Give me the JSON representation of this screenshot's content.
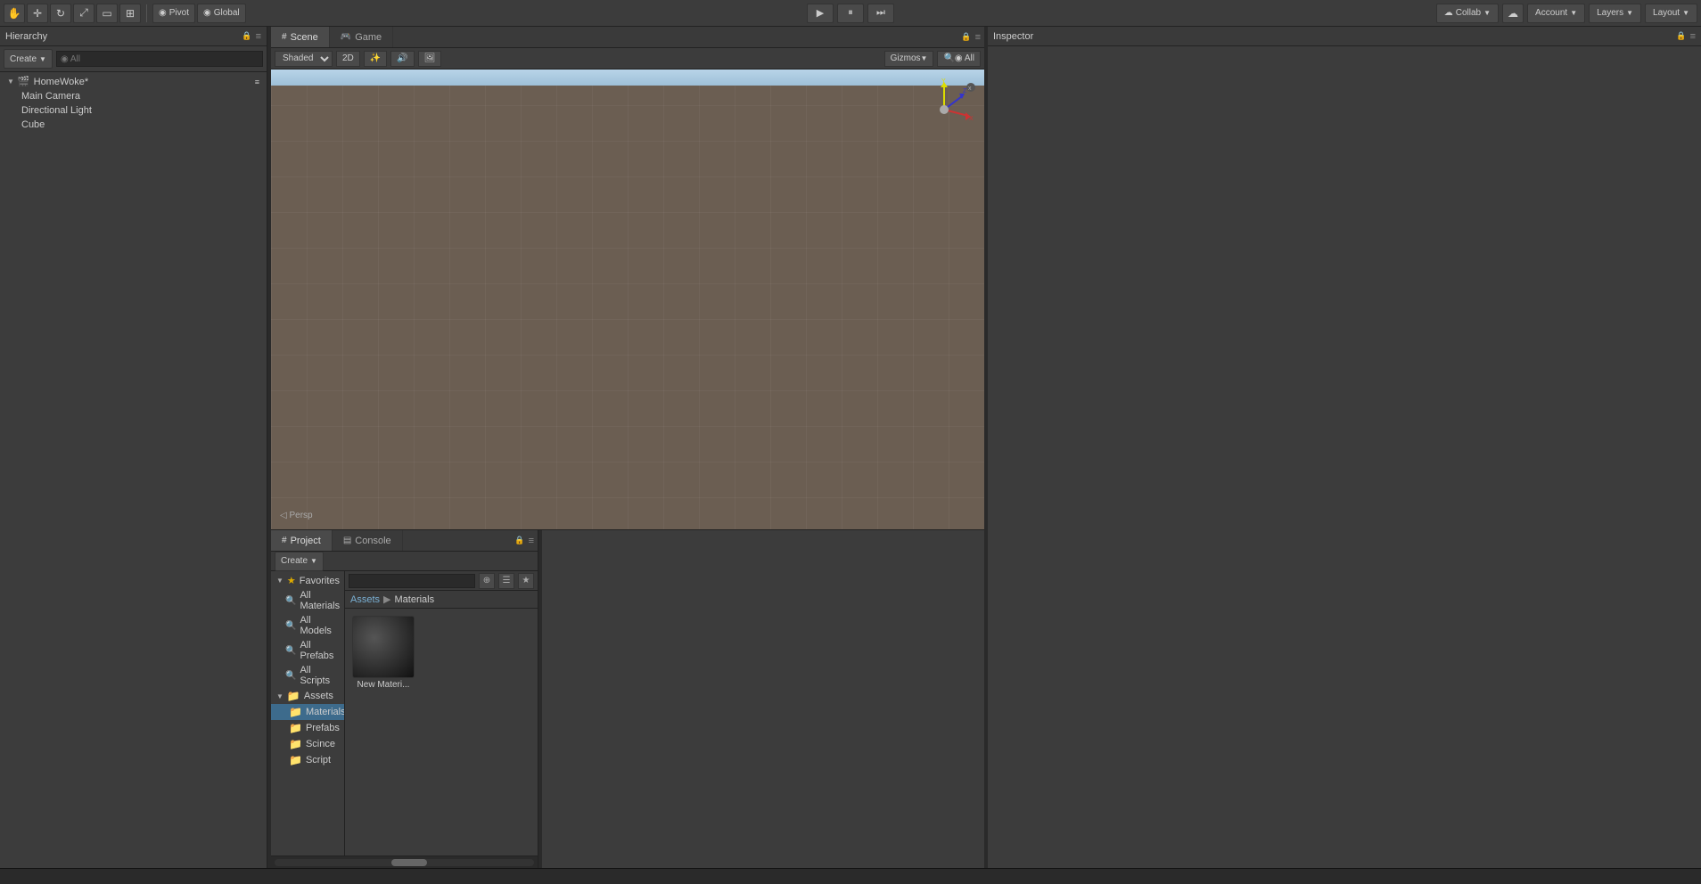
{
  "toolbar": {
    "pivot_label": "Pivot",
    "global_label": "Global",
    "collab_label": "Collab",
    "account_label": "Account",
    "layers_label": "Layers",
    "layout_label": "Layout"
  },
  "hierarchy": {
    "panel_title": "Hierarchy",
    "create_label": "Create",
    "search_placeholder": "◉ All",
    "scene_name": "HomeWoke*",
    "items": [
      {
        "label": "Main Camera",
        "indent": true
      },
      {
        "label": "Directional Light",
        "indent": true
      },
      {
        "label": "Cube",
        "indent": true
      }
    ]
  },
  "scene": {
    "tab_scene": "Scene",
    "tab_game": "Game",
    "shade_mode": "Shaded",
    "btn_2d": "2D",
    "gizmos_label": "Gizmos",
    "search_placeholder": "◉ All",
    "persp_label": "◁ Persp"
  },
  "inspector": {
    "panel_title": "Inspector"
  },
  "project": {
    "tab_project": "Project",
    "tab_console": "Console",
    "create_label": "Create",
    "search_placeholder": "",
    "favorites": {
      "label": "Favorites",
      "items": [
        {
          "label": "All Materials",
          "icon": "🔍"
        },
        {
          "label": "All Models",
          "icon": "🔍"
        },
        {
          "label": "All Prefabs",
          "icon": "🔍"
        },
        {
          "label": "All Scripts",
          "icon": "🔍"
        }
      ]
    },
    "assets": {
      "label": "Assets",
      "items": [
        {
          "label": "Materials",
          "selected": true
        },
        {
          "label": "Prefabs"
        },
        {
          "label": "Scince"
        },
        {
          "label": "Script"
        }
      ]
    },
    "breadcrumb": {
      "root": "Assets",
      "current": "Materials"
    },
    "materials": [
      {
        "label": "New Materi..."
      }
    ]
  },
  "colors": {
    "bg_dark": "#3c3c3c",
    "bg_darker": "#2a2a2a",
    "accent_blue": "#3d6b8c",
    "panel_border": "#222",
    "selected_folder": "#3d6b8c"
  }
}
